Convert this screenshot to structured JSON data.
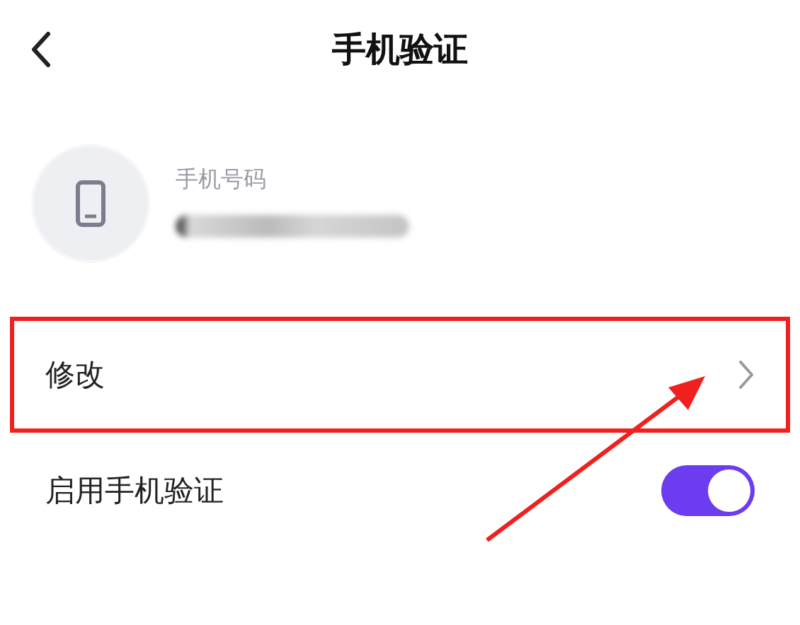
{
  "header": {
    "title": "手机验证"
  },
  "phone": {
    "label": "手机号码"
  },
  "settings": [
    {
      "kind": "link",
      "label": "修改",
      "highlighted": true
    },
    {
      "kind": "switch",
      "label": "启用手机验证",
      "on": true,
      "highlighted": false
    }
  ]
}
